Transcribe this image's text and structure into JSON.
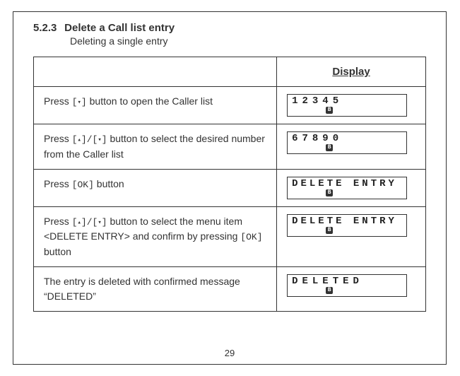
{
  "section": {
    "number": "5.2.3",
    "title": "Delete a Call list entry",
    "subtitle": "Deleting a single entry"
  },
  "display_header": "Display",
  "keys": {
    "down": "[▾]",
    "updown": "[▴]/[▾]",
    "ok": "[OK]"
  },
  "steps": [
    {
      "pre1": "Press ",
      "key1": "down",
      "post1": " button to open the Caller list",
      "lcd": "12345"
    },
    {
      "pre1": "Press ",
      "key1": "updown",
      "post1": " button to select the desired number from the Caller list",
      "lcd": "67890"
    },
    {
      "pre1": "Press ",
      "key1": "ok",
      "post1": " button",
      "lcd": "DELETE  ENTRY"
    },
    {
      "pre1": "Press ",
      "key1": "updown",
      "post1": " button to select the menu item <DELETE ENTRY> and confirm by pressing ",
      "key2": "ok",
      "post2": " button",
      "lcd": "DELETE  ENTRY"
    },
    {
      "pre1": "The entry is deleted  with confirmed message “DELETED”",
      "lcd": "DELETED"
    }
  ],
  "page_number": "29"
}
